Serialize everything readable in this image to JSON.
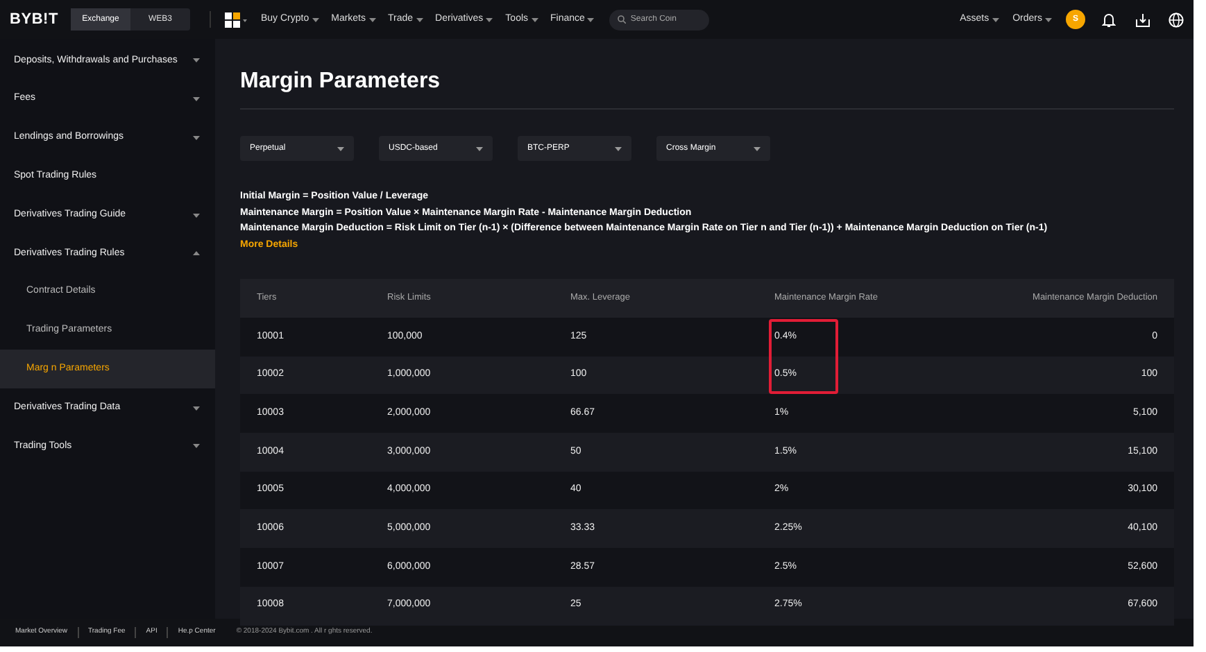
{
  "nav": {
    "logo": "BYB!T",
    "modes": [
      {
        "label": "Exchange",
        "selected": true
      },
      {
        "label": "WEB3",
        "selected": false
      }
    ],
    "menu": [
      "Buy Crypto",
      "Markets",
      "Trade",
      "Derivatives",
      "Tools",
      "Finance"
    ],
    "search": {
      "placeholder": "Search Coin"
    },
    "right_menu": [
      "Assets",
      "Orders"
    ],
    "avatar": "S"
  },
  "sidebar": {
    "items": [
      {
        "label": "Deposits, Withdrawals and Purchases",
        "kind": "section",
        "expanded": false,
        "selected": false
      },
      {
        "label": "Fees",
        "kind": "section",
        "expanded": false,
        "selected": false
      },
      {
        "label": "Lendings and Borrowings",
        "kind": "section",
        "expanded": false,
        "selected": false
      },
      {
        "label": "Spot Trading Rules",
        "kind": "page",
        "selected": false
      },
      {
        "label": "Derivatives Trading Guide",
        "kind": "section",
        "expanded": false,
        "selected": false
      },
      {
        "label": "Derivatives Trading Rules",
        "kind": "section",
        "expanded": true,
        "selected": false,
        "children": [
          {
            "label": "Contract Details",
            "selected": false
          },
          {
            "label": "Trading Parameters",
            "selected": false
          },
          {
            "label": "Marg n Parameters",
            "selected": true
          }
        ]
      },
      {
        "label": "Derivatives Trading Data",
        "kind": "section",
        "expanded": false,
        "selected": false
      },
      {
        "label": "Trading Tools",
        "kind": "section",
        "expanded": false,
        "selected": false
      }
    ]
  },
  "page": {
    "title": "Margin Parameters",
    "filters": [
      "Perpetual",
      "USDC-based",
      "BTC-PERP",
      "Cross Margin"
    ],
    "formulas": [
      "Initial Margin = Position Value / Leverage",
      "Maintenance Margin = Position Value × Maintenance Margin Rate - Maintenance Margin Deduction",
      "Maintenance Margin Deduction = Risk Limit on Tier (n-1) × (Difference between Maintenance Margin Rate on Tier n and Tier (n-1)) + Maintenance Margin Deduction on Tier (n-1)"
    ],
    "more_link": "More Details"
  },
  "table": {
    "columns": [
      "Tiers",
      "Risk Limits",
      "Max. Leverage",
      "Maintenance Margin Rate",
      "Maintenance Margin Deduction"
    ],
    "rows": [
      {
        "cells": [
          "10001",
          "100,000",
          "125",
          "0.4%",
          "0"
        ],
        "marked": true
      },
      {
        "cells": [
          "10002",
          "1,000,000",
          "100",
          "0.5%",
          "100"
        ],
        "marked": true
      },
      {
        "cells": [
          "10003",
          "2,000,000",
          "66.67",
          "1%",
          "5,100"
        ],
        "marked": false
      },
      {
        "cells": [
          "10004",
          "3,000,000",
          "50",
          "1.5%",
          "15,100"
        ],
        "marked": false
      },
      {
        "cells": [
          "10005",
          "4,000,000",
          "40",
          "2%",
          "30,100"
        ],
        "marked": false
      },
      {
        "cells": [
          "10006",
          "5,000,000",
          "33.33",
          "2.25%",
          "40,100"
        ],
        "marked": false
      },
      {
        "cells": [
          "10007",
          "6,000,000",
          "28.57",
          "2.5%",
          "52,600"
        ],
        "marked": false
      },
      {
        "cells": [
          "10008",
          "7,000,000",
          "25",
          "2.75%",
          "67,600"
        ],
        "marked": false
      }
    ]
  },
  "footer": {
    "links": [
      "Market Overview",
      "Trading Fee",
      "API",
      "He.p Center"
    ],
    "copyright": "© 2018-2024 Bybit.com . All r ghts reserved."
  }
}
